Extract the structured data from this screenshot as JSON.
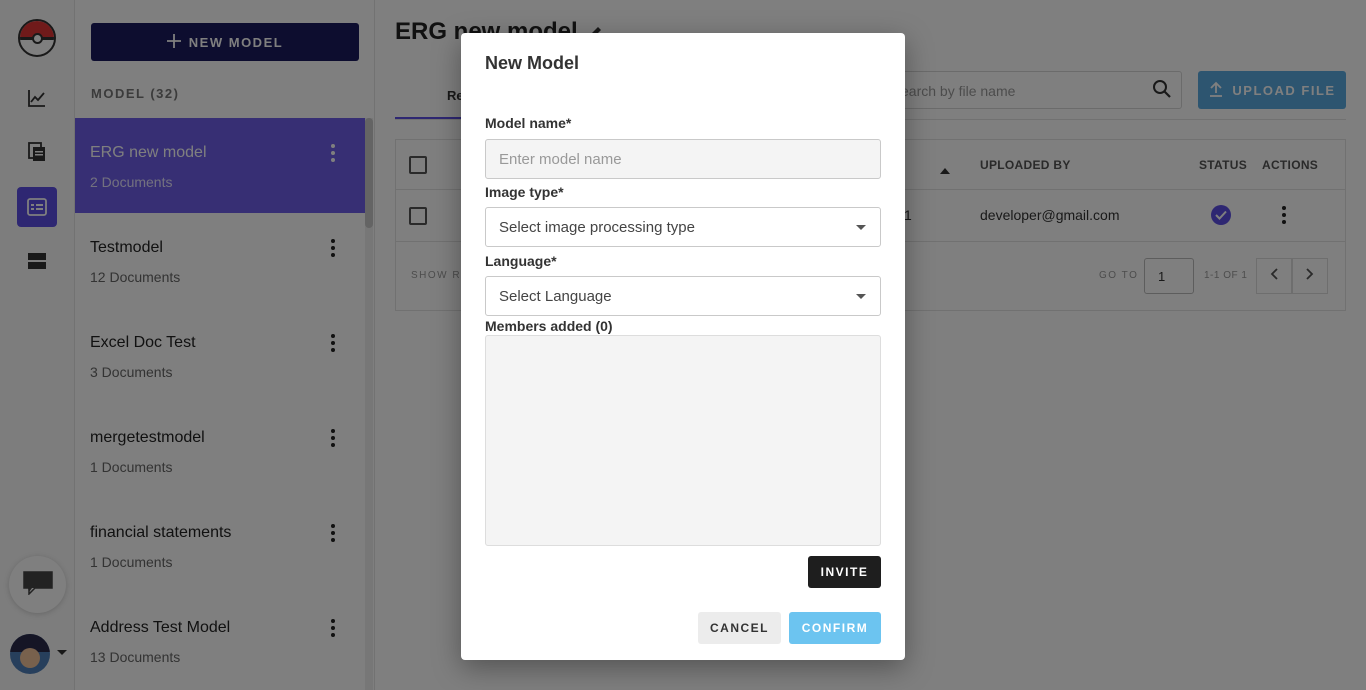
{
  "rail": {
    "logo": "pokeball-logo",
    "items": [
      {
        "name": "analytics",
        "icon": "line-chart-icon",
        "active": false
      },
      {
        "name": "documents",
        "icon": "documents-icon",
        "active": false
      },
      {
        "name": "models",
        "icon": "model-list-icon",
        "active": true
      },
      {
        "name": "storage",
        "icon": "storage-icon",
        "active": false
      }
    ],
    "chat_icon": "chat-icon",
    "accent": "#5c4ee5"
  },
  "panel": {
    "new_model_label": "NEW MODEL",
    "model_count_label": "MODEL (32)",
    "models": [
      {
        "name": "ERG new model",
        "docs": "2 Documents"
      },
      {
        "name": "Testmodel",
        "docs": "12 Documents"
      },
      {
        "name": "Excel Doc Test",
        "docs": "3 Documents"
      },
      {
        "name": "mergetestmodel",
        "docs": "1 Documents"
      },
      {
        "name": "financial statements",
        "docs": "1 Documents"
      },
      {
        "name": "Address Test Model",
        "docs": "13 Documents"
      }
    ]
  },
  "main": {
    "title": "ERG new model",
    "tab_label": "Re",
    "search_placeholder": "earch by file name",
    "upload_label": "UPLOAD FILE",
    "table": {
      "headers": {
        "uploaded_by": "UPLOADED BY",
        "status": "STATUS",
        "actions": "ACTIONS"
      },
      "row": {
        "col_partial": "1",
        "uploaded_by": "developer@gmail.com",
        "status_icon": "check-circle-icon"
      },
      "footer": {
        "show_rows": "SHOW RO",
        "goto_label": "GO TO",
        "goto_value": "1",
        "range": "1-1 OF 1"
      }
    }
  },
  "dialog": {
    "title": "New Model",
    "model_name_label": "Model name*",
    "model_name_placeholder": "Enter model name",
    "image_type_label": "Image type*",
    "image_type_value": "Select image processing type",
    "language_label": "Language*",
    "language_value": "Select Language",
    "members_label": "Members added (0)",
    "invite_label": "INVITE",
    "cancel_label": "CANCEL",
    "confirm_label": "CONFIRM",
    "confirm_color": "#6cc4f0"
  }
}
